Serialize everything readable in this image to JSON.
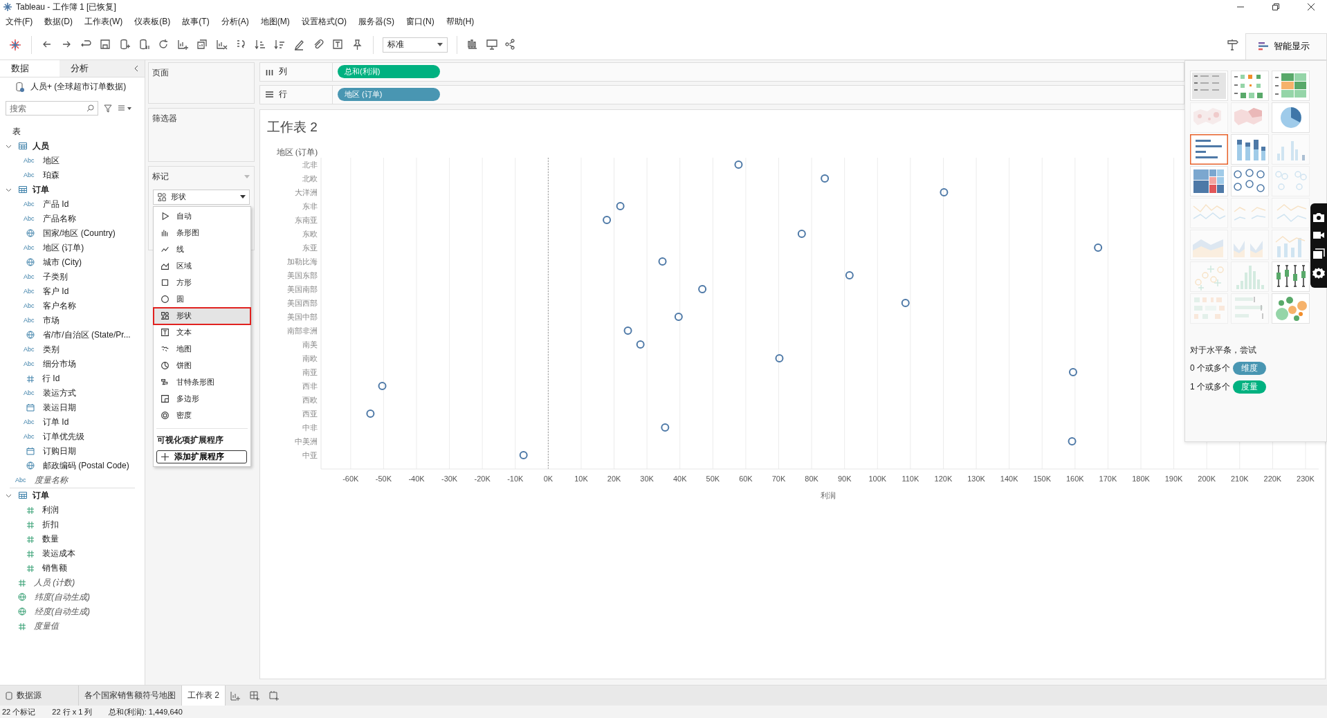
{
  "window": {
    "title": "Tableau - 工作簿 1 [已恢复]"
  },
  "menu": [
    "文件(F)",
    "数据(D)",
    "工作表(W)",
    "仪表板(B)",
    "故事(T)",
    "分析(A)",
    "地图(M)",
    "设置格式(O)",
    "服务器(S)",
    "窗口(N)",
    "帮助(H)"
  ],
  "toolbar": {
    "fit": "标准",
    "show_me": "智能显示"
  },
  "data_pane": {
    "tabs": [
      {
        "label": "数据",
        "selected": true
      },
      {
        "label": "分析",
        "selected": false
      }
    ],
    "datasource": "人员+ (全球超市订单数据)",
    "search": {
      "placeholder": "搜索"
    },
    "section": "表",
    "items": [
      {
        "kind": "table",
        "name": "人员",
        "expanded": true,
        "generated": false,
        "children": [
          {
            "kind": "string",
            "badge": "Abc",
            "name": "地区",
            "generated": false
          },
          {
            "kind": "string",
            "badge": "Abc",
            "name": "珀森",
            "generated": false
          }
        ]
      },
      {
        "kind": "table",
        "name": "订单",
        "expanded": true,
        "generated": false,
        "children": [
          {
            "kind": "string",
            "badge": "Abc",
            "name": "产品 Id",
            "generated": false
          },
          {
            "kind": "string",
            "badge": "Abc",
            "name": "产品名称",
            "generated": false
          },
          {
            "kind": "geo",
            "name": "国家/地区 (Country)",
            "generated": false
          },
          {
            "kind": "string",
            "badge": "Abc",
            "name": "地区 (订单)",
            "generated": false
          },
          {
            "kind": "geo",
            "name": "城市 (City)",
            "generated": false
          },
          {
            "kind": "string",
            "badge": "Abc",
            "name": "子类别",
            "generated": false
          },
          {
            "kind": "string",
            "badge": "Abc",
            "name": "客户 Id",
            "generated": false
          },
          {
            "kind": "string",
            "badge": "Abc",
            "name": "客户名称",
            "generated": false
          },
          {
            "kind": "string",
            "badge": "Abc",
            "name": "市场",
            "generated": false
          },
          {
            "kind": "geo",
            "name": "省/市/自治区 (State/Pr...",
            "generated": false
          },
          {
            "kind": "string",
            "badge": "Abc",
            "name": "类别",
            "generated": false
          },
          {
            "kind": "string",
            "badge": "Abc",
            "name": "细分市场",
            "generated": false
          },
          {
            "kind": "number",
            "name": "行 Id",
            "generated": false
          },
          {
            "kind": "string",
            "badge": "Abc",
            "name": "装运方式",
            "generated": false
          },
          {
            "kind": "date",
            "name": "装运日期",
            "generated": false
          },
          {
            "kind": "string",
            "badge": "Abc",
            "name": "订单 Id",
            "generated": false
          },
          {
            "kind": "string",
            "badge": "Abc",
            "name": "订单优先级",
            "generated": false
          },
          {
            "kind": "date",
            "name": "订购日期",
            "generated": false
          },
          {
            "kind": "geo",
            "name": "邮政编码 (Postal Code)",
            "generated": false
          }
        ]
      },
      {
        "kind": "string",
        "badge": "Abc",
        "name": "度量名称",
        "generated": true
      },
      {
        "kind": "table",
        "name": "订单",
        "expanded": true,
        "generated": false,
        "children": [
          {
            "kind": "number",
            "name": "利润",
            "generated": false
          },
          {
            "kind": "number",
            "name": "折扣",
            "generated": false
          },
          {
            "kind": "number",
            "name": "数量",
            "generated": false
          },
          {
            "kind": "number",
            "name": "装运成本",
            "generated": false
          },
          {
            "kind": "number",
            "name": "销售额",
            "generated": false
          }
        ]
      },
      {
        "kind": "number",
        "name": "人员 (计数)",
        "generated": true
      },
      {
        "kind": "geo",
        "name": "纬度(自动生成)",
        "generated": true
      },
      {
        "kind": "geo",
        "name": "经度(自动生成)",
        "generated": true
      },
      {
        "kind": "number",
        "name": "度量值",
        "generated": true
      }
    ]
  },
  "cards": {
    "pages": "页面",
    "filters": "筛选器"
  },
  "marks": {
    "label": "标记",
    "type_dropdown": "形状",
    "menu": [
      {
        "kind": "auto",
        "label": "自动",
        "selected": false
      },
      {
        "kind": "bar",
        "label": "条形图",
        "selected": false
      },
      {
        "kind": "line",
        "label": "线",
        "selected": false
      },
      {
        "kind": "area",
        "label": "区域",
        "selected": false
      },
      {
        "kind": "square",
        "label": "方形",
        "selected": false
      },
      {
        "kind": "circle",
        "label": "圆",
        "selected": false
      },
      {
        "kind": "shape",
        "label": "形状",
        "selected": true
      },
      {
        "kind": "text",
        "label": "文本",
        "selected": false
      },
      {
        "kind": "map",
        "label": "地图",
        "selected": false
      },
      {
        "kind": "pie",
        "label": "饼图",
        "selected": false
      },
      {
        "kind": "gantt",
        "label": "甘特条形图",
        "selected": false
      },
      {
        "kind": "polygon",
        "label": "多边形",
        "selected": false
      },
      {
        "kind": "density",
        "label": "密度",
        "selected": false
      }
    ],
    "extensions_header": "可视化项扩展程序",
    "add_extension": "添加扩展程序"
  },
  "shelves": [
    {
      "kind": "columns",
      "label": "列",
      "pills": [
        {
          "label": "总和(利润)",
          "color": "#00b180"
        }
      ]
    },
    {
      "kind": "rows",
      "label": "行",
      "pills": [
        {
          "label": "地区 (订单)",
          "color": "#4996b2"
        }
      ]
    }
  ],
  "sheet": {
    "title": "工作表 2",
    "chart_data": {
      "type": "scatter",
      "orientation": "horizontal",
      "xlabel": "利润",
      "ylabel": "地区 (订单)",
      "categories": [
        "北非",
        "北欧",
        "大洋洲",
        "东非",
        "东南亚",
        "东欧",
        "东亚",
        "加勒比海",
        "美国东部",
        "美国南部",
        "美国西部",
        "美国中部",
        "南部非洲",
        "南美",
        "南欧",
        "南亚",
        "西非",
        "西欧",
        "西亚",
        "中非",
        "中美洲",
        "中亚"
      ],
      "grid": true,
      "ref_lines": [
        {
          "axis": "x",
          "value": 0
        }
      ],
      "series": [
        {
          "color": "#4e79a7",
          "values": [
            57800,
            84000,
            120200,
            21900,
            17800,
            77000,
            167000,
            34700,
            91500,
            46800,
            108500,
            39600,
            24200,
            28000,
            70200,
            159400,
            -50400,
            null,
            -54000,
            35500,
            159100,
            -7500
          ]
        }
      ],
      "xlim": [
        -69000,
        234000
      ],
      "xticks": [
        {
          "value": -60000,
          "label": "-60K"
        },
        {
          "value": -50000,
          "label": "-50K"
        },
        {
          "value": -40000,
          "label": "-40K"
        },
        {
          "value": -30000,
          "label": "-30K"
        },
        {
          "value": -20000,
          "label": "-20K"
        },
        {
          "value": -10000,
          "label": "-10K"
        },
        {
          "value": 0,
          "label": "0K"
        },
        {
          "value": 10000,
          "label": "10K"
        },
        {
          "value": 20000,
          "label": "20K"
        },
        {
          "value": 30000,
          "label": "30K"
        },
        {
          "value": 40000,
          "label": "40K"
        },
        {
          "value": 50000,
          "label": "50K"
        },
        {
          "value": 60000,
          "label": "60K"
        },
        {
          "value": 70000,
          "label": "70K"
        },
        {
          "value": 80000,
          "label": "80K"
        },
        {
          "value": 90000,
          "label": "90K"
        },
        {
          "value": 100000,
          "label": "100K"
        },
        {
          "value": 110000,
          "label": "110K"
        },
        {
          "value": 120000,
          "label": "120K"
        },
        {
          "value": 130000,
          "label": "130K"
        },
        {
          "value": 140000,
          "label": "140K"
        },
        {
          "value": 150000,
          "label": "150K"
        },
        {
          "value": 160000,
          "label": "160K"
        },
        {
          "value": 170000,
          "label": "170K"
        },
        {
          "value": 180000,
          "label": "180K"
        },
        {
          "value": 190000,
          "label": "190K"
        },
        {
          "value": 200000,
          "label": "200K"
        },
        {
          "value": 210000,
          "label": "210K"
        },
        {
          "value": 220000,
          "label": "220K"
        },
        {
          "value": 230000,
          "label": "230K"
        }
      ]
    }
  },
  "show_me": {
    "charts": [
      {
        "kind": "text-table",
        "selected": false,
        "disabled": false
      },
      {
        "kind": "heat-map",
        "selected": false,
        "disabled": false
      },
      {
        "kind": "highlight-table",
        "selected": false,
        "disabled": false
      },
      {
        "kind": "symbol-map",
        "selected": false,
        "disabled": true
      },
      {
        "kind": "filled-map",
        "selected": false,
        "disabled": true
      },
      {
        "kind": "pie",
        "selected": false,
        "disabled": false
      },
      {
        "kind": "horizontal-bar",
        "selected": true,
        "disabled": false
      },
      {
        "kind": "stacked-bar",
        "selected": false,
        "disabled": false
      },
      {
        "kind": "side-by-side-bar",
        "selected": false,
        "disabled": true
      },
      {
        "kind": "treemap",
        "selected": false,
        "disabled": false
      },
      {
        "kind": "circle-view",
        "selected": false,
        "disabled": false
      },
      {
        "kind": "side-by-side-circle",
        "selected": false,
        "disabled": true
      },
      {
        "kind": "line-continuous",
        "selected": false,
        "disabled": true
      },
      {
        "kind": "line-discrete",
        "selected": false,
        "disabled": true
      },
      {
        "kind": "dual-line",
        "selected": false,
        "disabled": true
      },
      {
        "kind": "area-continuous",
        "selected": false,
        "disabled": true
      },
      {
        "kind": "area-discrete",
        "selected": false,
        "disabled": true
      },
      {
        "kind": "dual-combination",
        "selected": false,
        "disabled": true
      },
      {
        "kind": "scatter",
        "selected": false,
        "disabled": true
      },
      {
        "kind": "histogram",
        "selected": false,
        "disabled": true
      },
      {
        "kind": "box-whisker",
        "selected": false,
        "disabled": false
      },
      {
        "kind": "gantt",
        "selected": false,
        "disabled": true
      },
      {
        "kind": "bullet",
        "selected": false,
        "disabled": true
      },
      {
        "kind": "packed-bubbles",
        "selected": false,
        "disabled": false
      }
    ],
    "hint": "对于水平条，尝试",
    "requirements": [
      {
        "text": "0 个或多个",
        "pill": "维度",
        "color": "#4996b2"
      },
      {
        "text": "1 个或多个",
        "pill": "度量",
        "color": "#00b180"
      }
    ]
  },
  "sheet_tabs": [
    {
      "kind": "datasource",
      "label": "数据源",
      "selected": false
    },
    {
      "kind": "sheet",
      "label": "各个国家销售额符号地图",
      "selected": false
    },
    {
      "kind": "sheet",
      "label": "工作表 2",
      "selected": true
    }
  ],
  "status_bar": [
    "22 个标记",
    "22 行 x 1 列",
    "总和(利润): 1,449,640"
  ]
}
